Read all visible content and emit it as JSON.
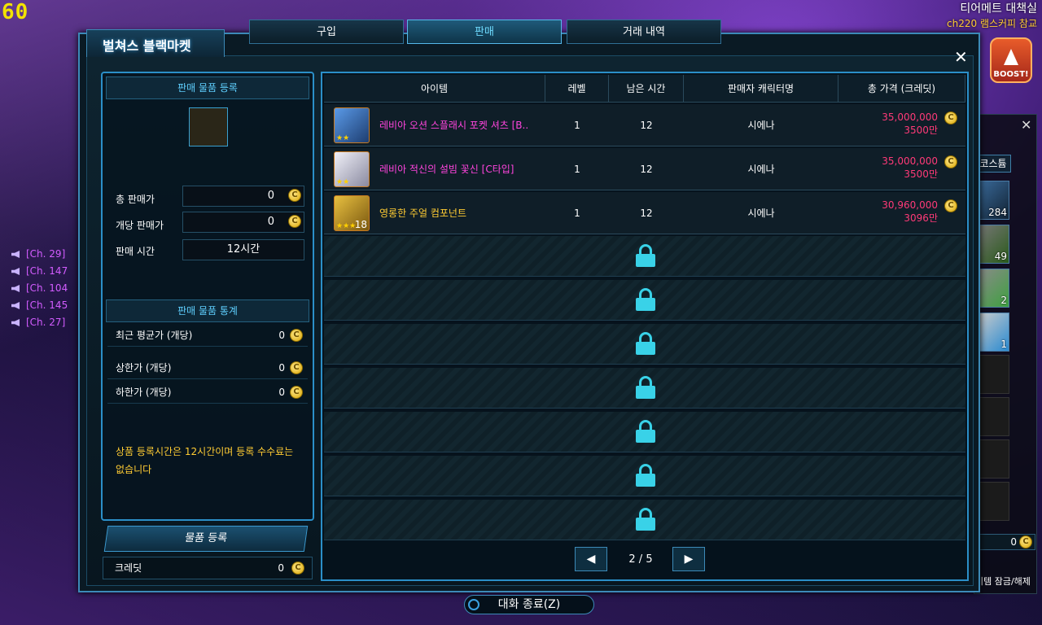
{
  "hud": {
    "fps": "60",
    "zone_title": "티어메트 대책실",
    "zone_channel": "ch220 램스커피 참교",
    "boost_label": "BOOST!"
  },
  "chat_lines": [
    "[Ch. 29]",
    "[Ch. 147",
    "[Ch. 104",
    "[Ch. 145",
    "[Ch. 27]"
  ],
  "window": {
    "title": "벌쳐스 블랙마켓",
    "tabs": [
      {
        "label": "구입"
      },
      {
        "label": "판매"
      },
      {
        "label": "거래 내역"
      }
    ],
    "active_tab": "판매",
    "close": "✕"
  },
  "register_panel": {
    "header": "판매 물품 등록",
    "total_price_label": "총 판매가",
    "total_price": "0",
    "unit_price_label": "개당 판매가",
    "unit_price": "0",
    "sale_time_label": "판매 시간",
    "sale_time": "12시간"
  },
  "stats_panel": {
    "header": "판매 물품 통계",
    "rows": [
      {
        "label": "최근 평균가 (개당)",
        "value": "0"
      },
      {
        "label": "상한가 (개당)",
        "value": "0"
      },
      {
        "label": "하한가 (개당)",
        "value": "0"
      }
    ],
    "note": "상품 등록시간은 12시간이며 등록 수수료는 없습니다"
  },
  "register_button": "물품 등록",
  "credit": {
    "label": "크레딧",
    "value": "0"
  },
  "table": {
    "headers": [
      "아이템",
      "레벨",
      "남은 시간",
      "판매자 캐릭터명",
      "총 가격 (크레딧)"
    ],
    "rows": [
      {
        "name": "레비아 오션 스플래시 포켓 셔츠 [B..",
        "stars": "★★",
        "count": "",
        "level": "1",
        "time": "12",
        "seller": "시에나",
        "price": "35,000,000",
        "price_short": "3500만",
        "name_color": "#ff44dd",
        "icon_color": "#4a86d8"
      },
      {
        "name": "레비아 적신의 설빔 꽃신 [C타입]",
        "stars": "★★",
        "count": "",
        "level": "1",
        "time": "12",
        "seller": "시에나",
        "price": "35,000,000",
        "price_short": "3500만",
        "name_color": "#ff44dd",
        "icon_color": "#d8d8e8"
      },
      {
        "name": "영롱한 주얼 컴포넌트",
        "stars": "★★★",
        "count": "18",
        "level": "1",
        "time": "12",
        "seller": "시에나",
        "price": "30,960,000",
        "price_short": "3096만",
        "name_color": "#ffcc33",
        "icon_color": "#c89a20"
      }
    ],
    "locked_rows": 7
  },
  "pager": {
    "text": "2 / 5",
    "prev": "◀",
    "next": "▶"
  },
  "inventory": {
    "tab": "코스튬",
    "close": "✕",
    "slots": [
      {
        "qty": "284"
      },
      {
        "qty": "49"
      },
      {
        "qty": "2"
      },
      {
        "qty": "1"
      }
    ],
    "credit": "0",
    "lock_label": "이템 잠금/해제"
  },
  "exit_button": "대화 종료(Z)"
}
